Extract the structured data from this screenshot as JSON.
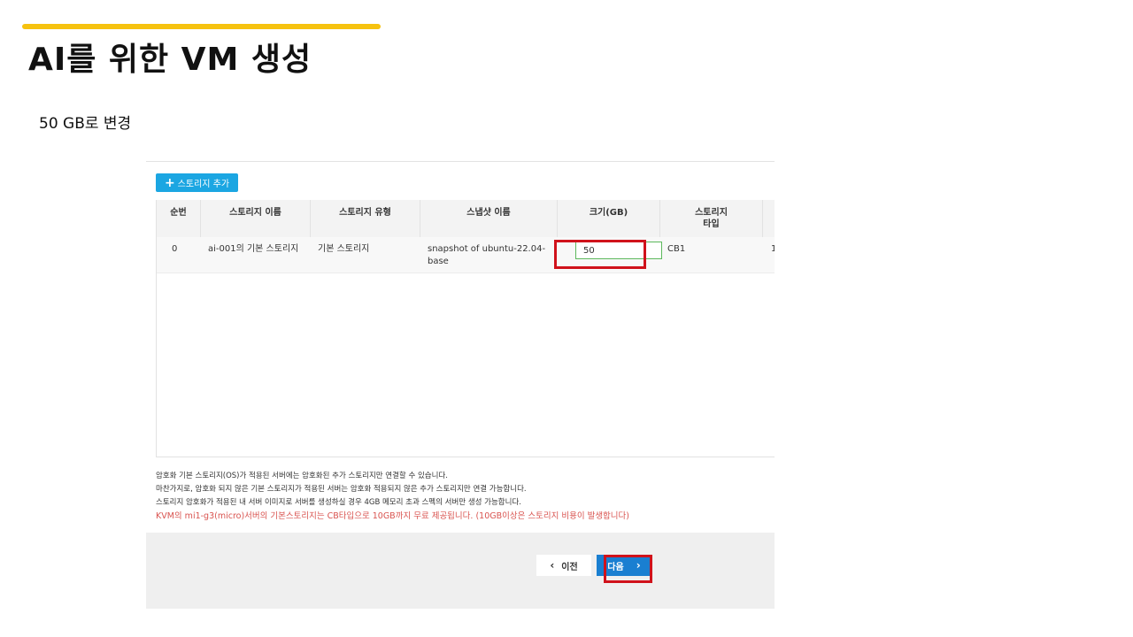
{
  "slide": {
    "title": "AI를 위한 VM 생성",
    "subtitle": "50 GB로 변경",
    "accent_color": "#f6c20f"
  },
  "toolbar": {
    "add_storage_label": "스토리지 추가",
    "add_icon": "plus-icon"
  },
  "table": {
    "headers": {
      "index": "순번",
      "name": "스토리지 이름",
      "type": "스토리지 유형",
      "snapshot": "스냅샷 이름",
      "size": "크기(GB)",
      "storage_type_line1": "스토리지",
      "storage_type_line2": "타입"
    },
    "rows": [
      {
        "index": "0",
        "name": "ai-001의 기본 스토리지",
        "type": "기본 스토리지",
        "snapshot_line1": "snapshot of ubuntu-22.04-",
        "snapshot_line2": "base",
        "size": "50",
        "storage_type": "CB1",
        "extra": "1"
      }
    ]
  },
  "notes": {
    "line1": "암호화 기본 스토리지(OS)가 적용된 서버에는 암호화된 추가 스토리지만 연결할 수 있습니다.",
    "line2": "마찬가지로, 암호화 되지 않은 기본 스토리지가 적용된 서버는 암호화 적용되지 않은 추가 스토리지만 연결 가능합니다.",
    "line3": "스토리지 암호화가 적용된 내 서버 이미지로 서버를 생성하실 경우 4GB 메모리 초과 스펙의 서버만 생성 가능합니다.",
    "warning": "KVM의 mi1-g3(micro)서버의 기본스토리지는 CB타입으로 10GB까지 무료 제공됩니다. (10GB이상은 스토리지 비용이 발생합니다)",
    "warning_color": "#d9534f"
  },
  "footer": {
    "prev_label": "이전",
    "next_label": "다음",
    "prev_icon": "chevron-left-icon",
    "next_icon": "chevron-right-icon",
    "next_color": "#1a7fd1"
  },
  "highlight_color": "#d0121b"
}
